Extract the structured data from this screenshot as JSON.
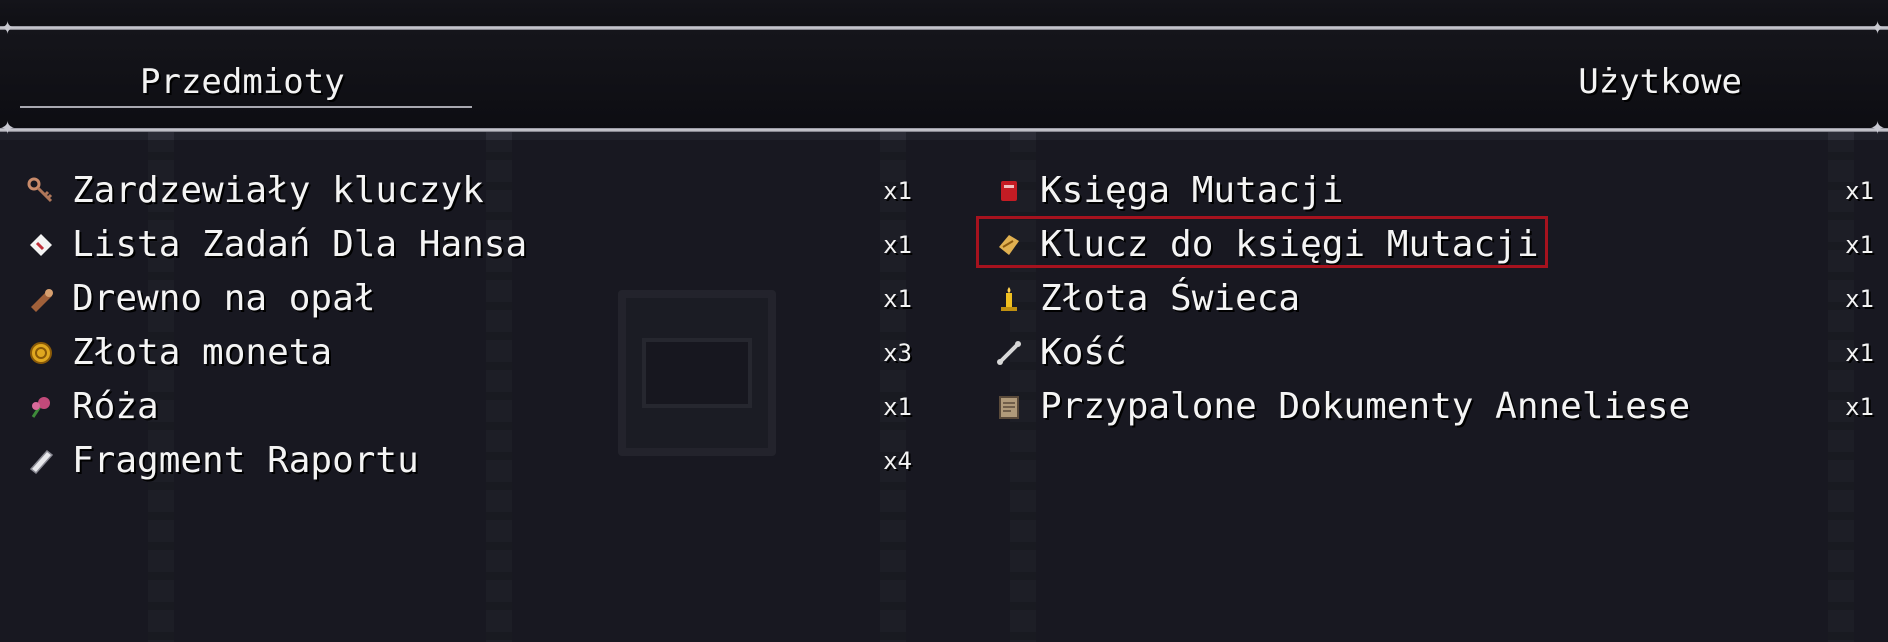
{
  "tabs": {
    "items_label": "Przedmioty",
    "consumables_label": "Użytkowe"
  },
  "left_items": [
    {
      "icon": "rusty-key-icon",
      "name": "Zardzewiały kluczyk",
      "qty": "x1"
    },
    {
      "icon": "letter-icon",
      "name": "Lista Zadań Dla Hansa",
      "qty": "x1"
    },
    {
      "icon": "firewood-icon",
      "name": "Drewno na opał",
      "qty": "x1"
    },
    {
      "icon": "gold-coin-icon",
      "name": "Złota moneta",
      "qty": "x3"
    },
    {
      "icon": "rose-icon",
      "name": "Róża",
      "qty": "x1"
    },
    {
      "icon": "scroll-icon",
      "name": "Fragment Raportu",
      "qty": "x4"
    }
  ],
  "right_items": [
    {
      "icon": "red-book-icon",
      "name": "Księga Mutacji",
      "qty": "x1"
    },
    {
      "icon": "parchment-key-icon",
      "name": "Klucz do księgi Mutacji",
      "qty": "x1",
      "selected": true
    },
    {
      "icon": "candle-icon",
      "name": "Złota Świeca",
      "qty": "x1"
    },
    {
      "icon": "bone-icon",
      "name": "Kość",
      "qty": "x1"
    },
    {
      "icon": "burnt-document-icon",
      "name": "Przypalone Dokumenty Anneliese",
      "qty": "x1"
    }
  ],
  "colors": {
    "cursor": "#a6121e",
    "text": "#f4f4f4",
    "window": "#15151b"
  }
}
